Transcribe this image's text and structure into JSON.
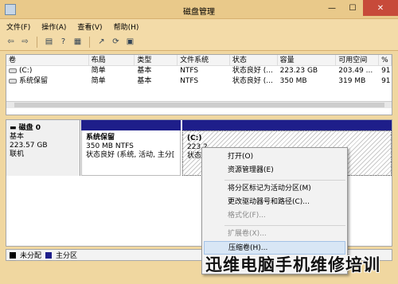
{
  "window": {
    "title": "磁盘管理",
    "minimize": "—",
    "maximize": "☐",
    "close": "✕"
  },
  "menu": [
    "文件(F)",
    "操作(A)",
    "查看(V)",
    "帮助(H)"
  ],
  "toolbar": {
    "icons": [
      "back-arrow-icon",
      "forward-arrow-icon",
      "console-tree-icon",
      "help-icon",
      "properties-icon",
      "export-icon",
      "refresh-icon",
      "help-book-icon"
    ],
    "glyphs": [
      "⇦",
      "⇨",
      "▤",
      "?",
      "▦",
      "↗",
      "⟳",
      "▣"
    ]
  },
  "volume_table": {
    "columns": [
      "卷",
      "布局",
      "类型",
      "文件系统",
      "状态",
      "容量",
      "可用空间",
      "%"
    ],
    "rows": [
      [
        "(C:)",
        "简单",
        "基本",
        "NTFS",
        "状态良好 (...",
        "223.23 GB",
        "203.49 ...",
        "91"
      ],
      [
        "系统保留",
        "简单",
        "基本",
        "NTFS",
        "状态良好 (...",
        "350 MB",
        "319 MB",
        "91"
      ]
    ]
  },
  "disk": {
    "name": "磁盘 0",
    "type": "基本",
    "size": "223.57 GB",
    "status": "联机",
    "partitions": [
      {
        "name": "系统保留",
        "size": "350 MB NTFS",
        "status": "状态良好 (系统, 活动, 主分["
      },
      {
        "name": "(C:)",
        "size": "223.2",
        "status": "状态良"
      }
    ]
  },
  "legend": [
    {
      "label": "未分配",
      "color": "#000000"
    },
    {
      "label": "主分区",
      "color": "#1e1e8a"
    }
  ],
  "context_menu": {
    "items": [
      {
        "label": "打开(O)",
        "enabled": true
      },
      {
        "label": "资源管理器(E)",
        "enabled": true
      },
      {
        "label": "将分区标记为活动分区(M)",
        "enabled": true
      },
      {
        "label": "更改驱动器号和路径(C)...",
        "enabled": true
      },
      {
        "label": "格式化(F)...",
        "enabled": false
      },
      {
        "label": "扩展卷(X)...",
        "enabled": false
      },
      {
        "label": "压缩卷(H)...",
        "enabled": true,
        "highlighted": true
      }
    ]
  },
  "watermark": "迅维电脑手机维修培训"
}
